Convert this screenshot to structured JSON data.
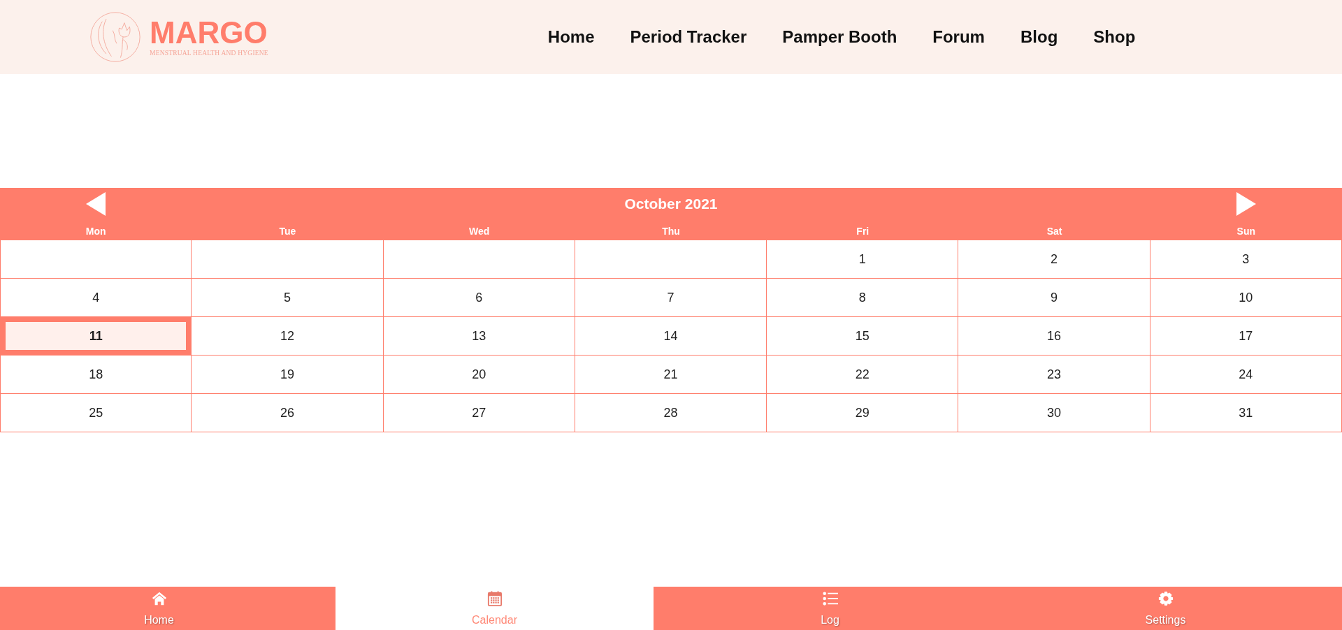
{
  "header": {
    "logo": {
      "name": "MARGO",
      "tagline": "MENSTRUAL HEALTH AND HYGIENE"
    },
    "nav": [
      {
        "label": "Home"
      },
      {
        "label": "Period Tracker"
      },
      {
        "label": "Pamper Booth"
      },
      {
        "label": "Forum"
      },
      {
        "label": "Blog"
      },
      {
        "label": "Shop"
      }
    ]
  },
  "calendar": {
    "title": "October 2021",
    "weekdays": [
      "Mon",
      "Tue",
      "Wed",
      "Thu",
      "Fri",
      "Sat",
      "Sun"
    ],
    "weeks": [
      {
        "cells": [
          {
            "kind": "empty",
            "selected": false
          },
          {
            "kind": "empty",
            "selected": false
          },
          {
            "kind": "empty",
            "selected": false
          },
          {
            "kind": "empty",
            "selected": false
          },
          {
            "kind": "day",
            "label": "1",
            "selected": false
          },
          {
            "kind": "day",
            "label": "2",
            "selected": false
          },
          {
            "kind": "day",
            "label": "3",
            "selected": false
          }
        ]
      },
      {
        "cells": [
          {
            "kind": "day",
            "label": "4",
            "selected": false
          },
          {
            "kind": "day",
            "label": "5",
            "selected": false
          },
          {
            "kind": "day",
            "label": "6",
            "selected": false
          },
          {
            "kind": "day",
            "label": "7",
            "selected": false
          },
          {
            "kind": "day",
            "label": "8",
            "selected": false
          },
          {
            "kind": "day",
            "label": "9",
            "selected": false
          },
          {
            "kind": "day",
            "label": "10",
            "selected": false
          }
        ]
      },
      {
        "cells": [
          {
            "kind": "day",
            "label": "11",
            "selected": true
          },
          {
            "kind": "day",
            "label": "12",
            "selected": false
          },
          {
            "kind": "day",
            "label": "13",
            "selected": false
          },
          {
            "kind": "day",
            "label": "14",
            "selected": false
          },
          {
            "kind": "day",
            "label": "15",
            "selected": false
          },
          {
            "kind": "day",
            "label": "16",
            "selected": false
          },
          {
            "kind": "day",
            "label": "17",
            "selected": false
          }
        ]
      },
      {
        "cells": [
          {
            "kind": "day",
            "label": "18",
            "selected": false
          },
          {
            "kind": "day",
            "label": "19",
            "selected": false
          },
          {
            "kind": "day",
            "label": "20",
            "selected": false
          },
          {
            "kind": "day",
            "label": "21",
            "selected": false
          },
          {
            "kind": "day",
            "label": "22",
            "selected": false
          },
          {
            "kind": "day",
            "label": "23",
            "selected": false
          },
          {
            "kind": "day",
            "label": "24",
            "selected": false
          }
        ]
      },
      {
        "cells": [
          {
            "kind": "day",
            "label": "25",
            "selected": false
          },
          {
            "kind": "day",
            "label": "26",
            "selected": false
          },
          {
            "kind": "day",
            "label": "27",
            "selected": false
          },
          {
            "kind": "day",
            "label": "28",
            "selected": false
          },
          {
            "kind": "day",
            "label": "29",
            "selected": false
          },
          {
            "kind": "day",
            "label": "30",
            "selected": false
          },
          {
            "kind": "day",
            "label": "31",
            "selected": false
          }
        ]
      }
    ]
  },
  "bottom_nav": {
    "tabs": [
      {
        "label": "Home",
        "selected": false
      },
      {
        "label": "Calendar",
        "selected": true
      },
      {
        "label": "Log",
        "selected": false
      },
      {
        "label": "Settings",
        "selected": false
      }
    ]
  }
}
